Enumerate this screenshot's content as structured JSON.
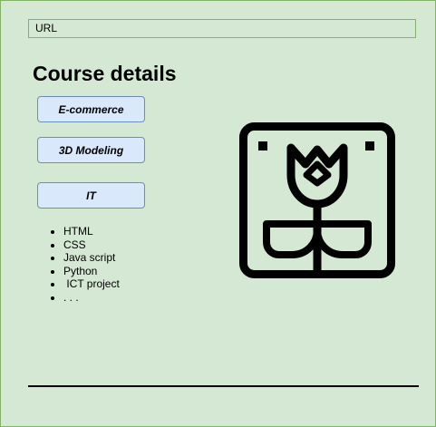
{
  "url_bar": {
    "text": "URL"
  },
  "page": {
    "title": "Course details"
  },
  "courses": [
    {
      "label": "E-commerce"
    },
    {
      "label": "3D Modeling"
    },
    {
      "label": "IT"
    }
  ],
  "topics": [
    "HTML",
    "CSS",
    "Java script",
    "Python",
    " ICT project",
    ". . ."
  ],
  "illustration": {
    "icon": "tulip-in-frame-icon"
  },
  "colors": {
    "background": "#d5e8d4",
    "frame_border": "#82b366",
    "button_fill": "#dae8fc",
    "button_border": "#6c8ebf",
    "ink": "#000000"
  }
}
